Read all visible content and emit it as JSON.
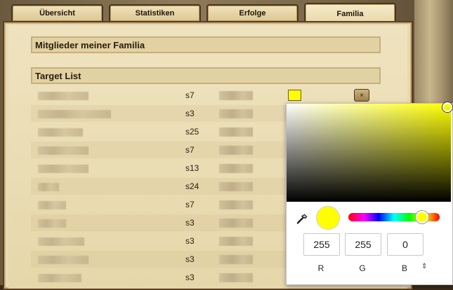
{
  "tabs": [
    {
      "label": "Übersicht"
    },
    {
      "label": "Statistiken"
    },
    {
      "label": "Erfolge"
    },
    {
      "label": "Familia"
    }
  ],
  "sections": {
    "members_title": "Mitglieder meiner Familia",
    "target_title": "Target List"
  },
  "targets": [
    {
      "server": "s7"
    },
    {
      "server": "s3"
    },
    {
      "server": "s25"
    },
    {
      "server": "s7"
    },
    {
      "server": "s13"
    },
    {
      "server": "s24"
    },
    {
      "server": "s7"
    },
    {
      "server": "s3"
    },
    {
      "server": "s3"
    },
    {
      "server": "s3"
    },
    {
      "server": "s3"
    }
  ],
  "delete_label": "×",
  "swatch_color": "#ffff00",
  "picker": {
    "r": "255",
    "g": "255",
    "b": "0",
    "r_label": "R",
    "g_label": "G",
    "b_label": "B",
    "mode_toggle": "⇕",
    "current_color": "#ffff00"
  }
}
